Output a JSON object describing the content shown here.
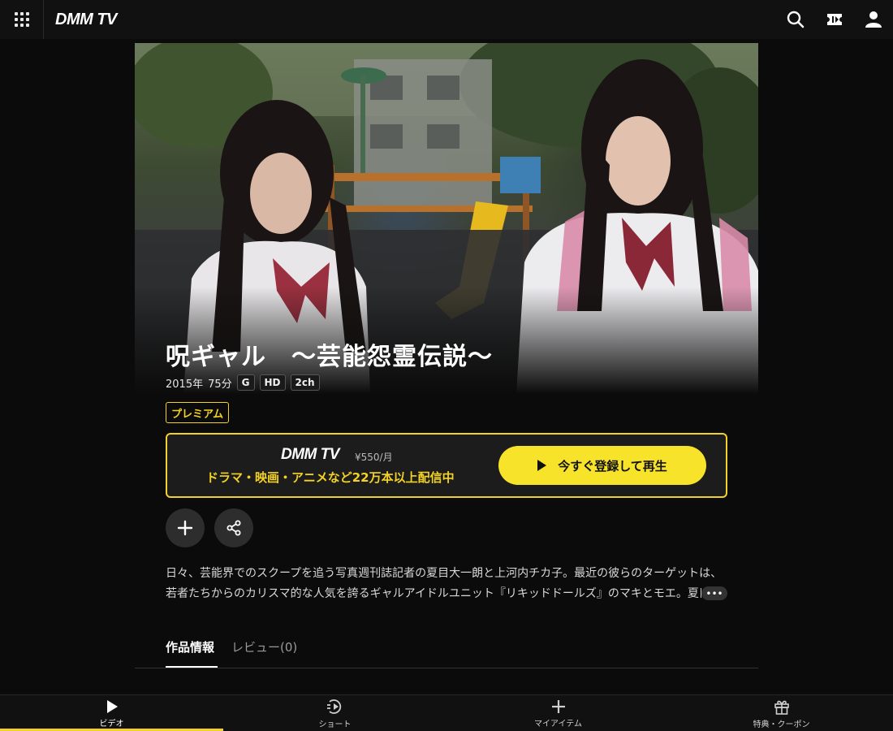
{
  "header": {
    "logo": "DMM TV",
    "icons": [
      "apps-grid-icon",
      "search-icon",
      "ticket-icon",
      "user-icon"
    ]
  },
  "content": {
    "title": "呪ギャル　～芸能怨霊伝説～",
    "year": "2015年",
    "duration": "75分",
    "badges": [
      "G",
      "HD",
      "2ch"
    ],
    "premium_label": "プレミアム"
  },
  "promo": {
    "logo": "DMM TV",
    "price": "¥550/月",
    "subtitle": "ドラマ・映画・アニメなど22万本以上配信中",
    "button_label": "今すぐ登録して再生"
  },
  "actions": {
    "add_icon": "plus-icon",
    "share_icon": "share-icon"
  },
  "description": {
    "line1": "日々、芸能界でのスクープを追う写真週刊誌記者の夏目大一朗と上河内チカ子。最近の彼らのターゲットは、",
    "line2": "若者たちからのカリスマ的な人気を誇るギャルアイドルユニット『リキッドドールズ』のマキとモエ。夏目",
    "more_label": "•••"
  },
  "tabs": [
    {
      "label": "作品情報",
      "active": true
    },
    {
      "label": "レビュー(0)",
      "active": false
    }
  ],
  "bottom_nav": [
    {
      "label": "ビデオ",
      "icon": "play-icon",
      "active": true
    },
    {
      "label": "ショート",
      "icon": "short-play-icon",
      "active": false
    },
    {
      "label": "マイアイテム",
      "icon": "plus-icon",
      "active": false
    },
    {
      "label": "特典・クーポン",
      "icon": "gift-icon",
      "active": false
    }
  ],
  "colors": {
    "accent": "#f3d225",
    "background": "#0b0b0b",
    "button_bg": "#f7e32a"
  }
}
